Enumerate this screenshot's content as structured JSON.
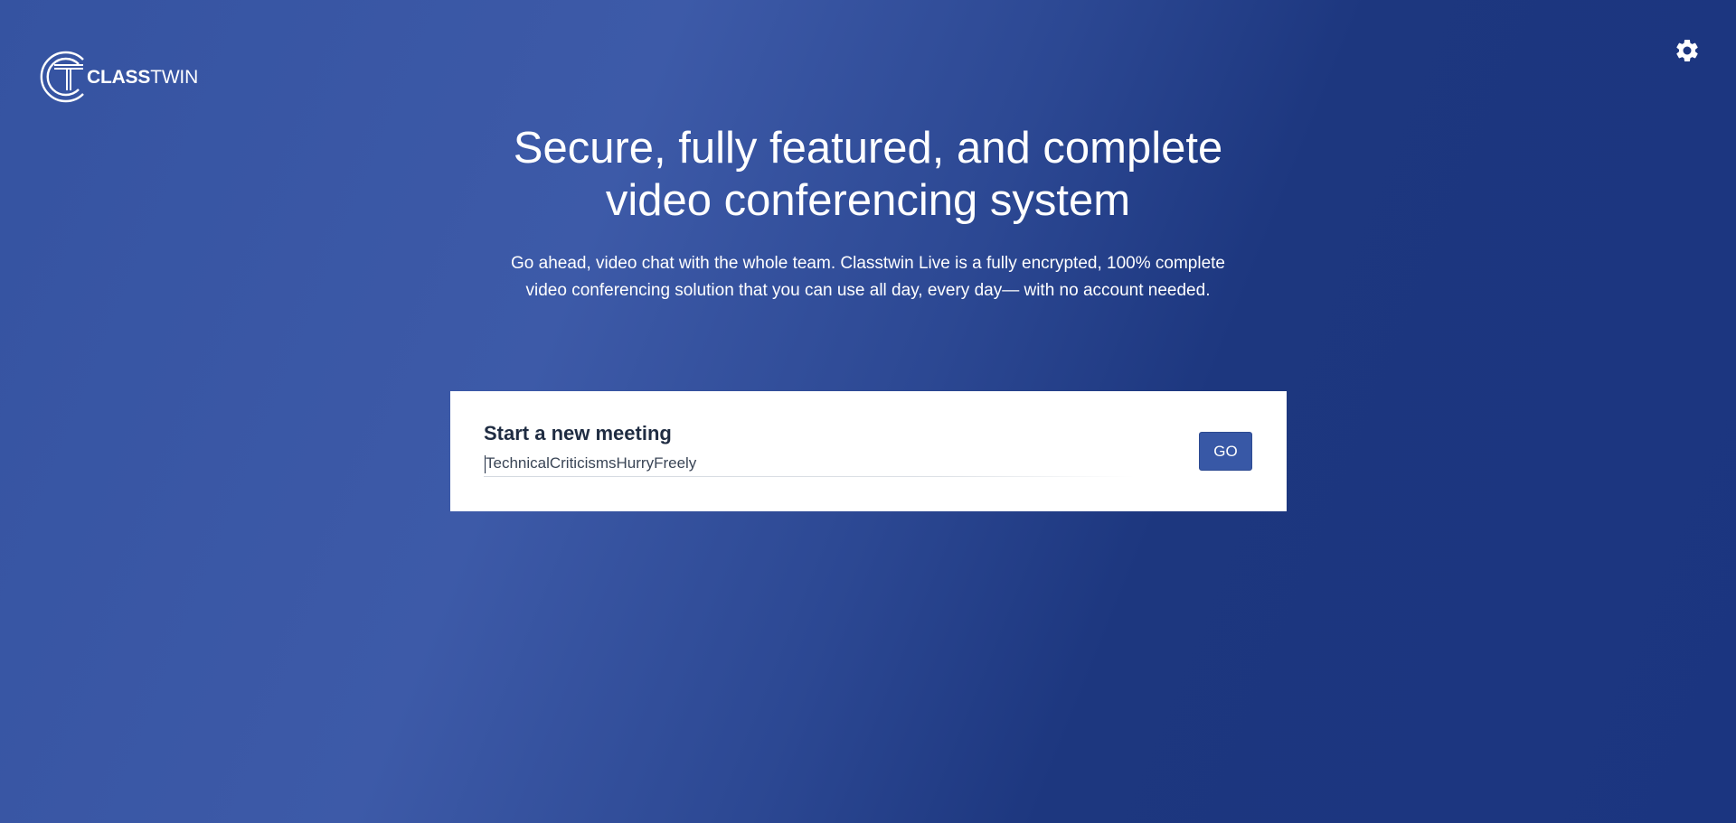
{
  "brand": {
    "name_bold": "CLASS",
    "name_light": "TWIN",
    "logo_icon": "classtwin-logo-icon"
  },
  "header": {
    "settings_icon": "gear-icon"
  },
  "hero": {
    "title": "Secure, fully featured, and complete video conferencing system",
    "description": "Go ahead, video chat with the whole team. Classtwin Live is a fully encrypted, 100% complete video conferencing solution that you can use all day, every day— with no account needed."
  },
  "meeting": {
    "title": "Start a new meeting",
    "input_value": "TechnicalCriticismsHurryFreely",
    "go_label": "GO"
  },
  "colors": {
    "background_start": "#3d5aa8",
    "background_end": "#1b3580",
    "button": "#3858a6",
    "card_title": "#1f2c42"
  }
}
